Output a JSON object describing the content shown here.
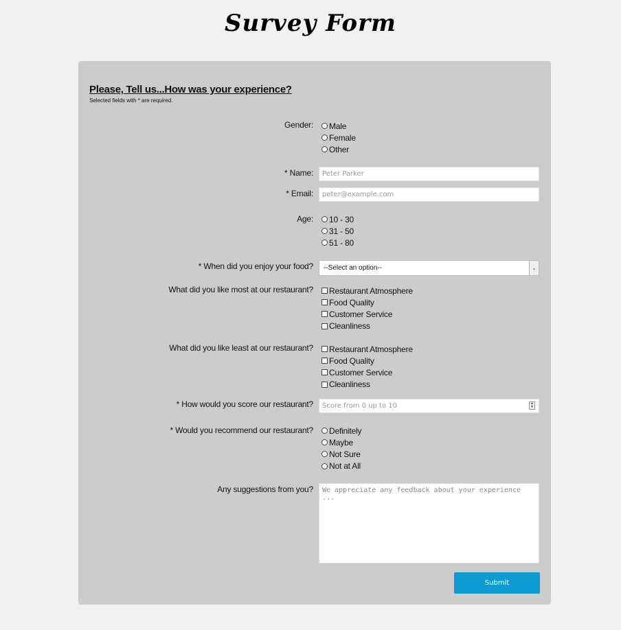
{
  "page": {
    "title": "Survey Form"
  },
  "form": {
    "headline": "Please, Tell us...How was your experience?",
    "required_note": "Selected fields with * are required.",
    "gender": {
      "label": "Gender:",
      "options": [
        "Male",
        "Female",
        "Other"
      ]
    },
    "name": {
      "label": "* Name:",
      "placeholder": "Peter Parker"
    },
    "email": {
      "label": "* Email:",
      "placeholder": "peter@example.com"
    },
    "age": {
      "label": "Age:",
      "options": [
        "10 - 30",
        "31 - 50",
        "51 - 80"
      ]
    },
    "food_time": {
      "label": "* When did you enjoy your food?",
      "selected": "--Select an option--"
    },
    "liked_most": {
      "label": "What did you like most at our restaurant?",
      "options": [
        "Restaurant Atmosphere",
        "Food Quality",
        "Customer Service",
        "Cleanliness"
      ]
    },
    "liked_least": {
      "label": "What did you like least at our restaurant?",
      "options": [
        "Restaurant Atmosphere",
        "Food Quality",
        "Customer Service",
        "Cleanliness"
      ]
    },
    "score": {
      "label": "* How would you score our restaurant?",
      "placeholder": "Score from 0 up to 10"
    },
    "recommend": {
      "label": "* Would you recommend our restaurant?",
      "options": [
        "Definitely",
        "Maybe",
        "Not Sure",
        "Not at All"
      ]
    },
    "suggestions": {
      "label": "Any suggestions from you?",
      "placeholder": "We appreciate any feedback about your experience ..."
    },
    "submit_label": "Submit"
  },
  "colors": {
    "page_bg": "#f1f1f1",
    "card_bg": "#cccccc",
    "submit_bg": "#0d9ad1"
  },
  "icons": {
    "select_arrow": "chevron-down-icon",
    "spinner": "spinner-arrows-icon"
  }
}
